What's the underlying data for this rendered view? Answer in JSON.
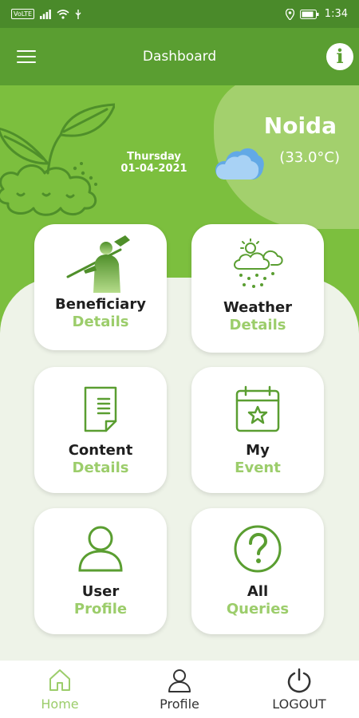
{
  "status_bar": {
    "sim_label": "VoLTE",
    "time": "1:34"
  },
  "app_bar": {
    "title": "Dashboard",
    "info_label": "i"
  },
  "weather_header": {
    "weekday": "Thursday",
    "date": "01-04-2021",
    "city": "Noida",
    "temperature": "(33.0°C)"
  },
  "cards": [
    {
      "line1": "Beneficiary",
      "line2": "Details"
    },
    {
      "line1": "Weather",
      "line2": "Details"
    },
    {
      "line1": "Content",
      "line2": "Details"
    },
    {
      "line1": "My",
      "line2": "Event"
    },
    {
      "line1": "User",
      "line2": "Profile"
    },
    {
      "line1": "All",
      "line2": "Queries"
    }
  ],
  "bottom_nav": [
    {
      "label": "Home",
      "active": true
    },
    {
      "label": "Profile",
      "active": false
    },
    {
      "label": "LOGOUT",
      "active": false
    }
  ],
  "colors": {
    "status_bar": "#4a8a2a",
    "app_bar": "#5a9e31",
    "header": "#7cbf3e",
    "accent_light": "#9ccd6b",
    "icon_green": "#5a9e31",
    "background": "#eef3e8"
  }
}
